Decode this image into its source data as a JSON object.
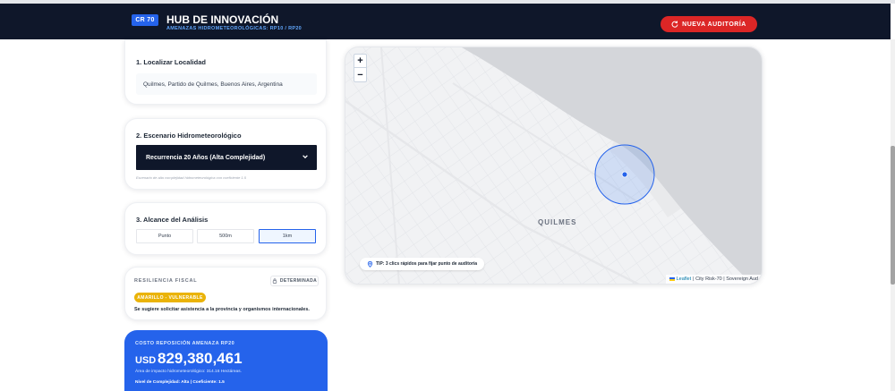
{
  "header": {
    "badge": "CR 70",
    "title": "HUB DE INNOVACIÓN",
    "subtitle": "AMENAZAS HIDROMETEOROLÓGICAS: RP10 / RP20",
    "new_audit_label": "NUEVA AUDITORÍA"
  },
  "locate": {
    "title": "1. Localizar Localidad",
    "value": "Quilmes, Partido de Quilmes, Buenos Aires, Argentina"
  },
  "scenario": {
    "title": "2. Escenario Hidrometeorológico",
    "selected": "Recurrencia 20 Años (Alta Complejidad)",
    "hint": "Escenario de alta complejidad hidrometeorológica con coeficiente 1.5"
  },
  "range": {
    "title": "3. Alcance del Análisis",
    "options": [
      "Punto",
      "500m",
      "1km"
    ],
    "selected_index": 2
  },
  "fiscal": {
    "label": "RESILIENCIA FISCAL",
    "button": "DETERMINADA",
    "status": "AMARILLO - VULNERABLE",
    "note": "Se sugiere solicitar asistencia a la provincia y organismos internacionales."
  },
  "cost": {
    "label": "COSTO REPOSICIÓN AMENAZA RP20",
    "currency": "USD",
    "value": "829,380,461",
    "area": "Área de impacto hidrometeorológico: 314.16 Hectáreas.",
    "level": "Nivel de Complejidad: Alta | Coeficiente: 1.5"
  },
  "map": {
    "zoom_in": "+",
    "zoom_out": "−",
    "city": "QUILMES",
    "tip": "TIP: 3 clics rápidos para fijar punto de auditoría",
    "attrib_leaflet": "Leaflet",
    "attrib_rest": "| City Risk-70 | Sovereign Aud"
  },
  "colors": {
    "header_bg": "#0f172a",
    "accent": "#2563eb",
    "danger": "#dc2626",
    "warning": "#eab308",
    "water": "#d4d6da"
  },
  "icons": {
    "refresh": "refresh-icon",
    "chevron": "chevron-down-icon",
    "lock": "lock-icon",
    "pin": "map-pin-icon"
  }
}
